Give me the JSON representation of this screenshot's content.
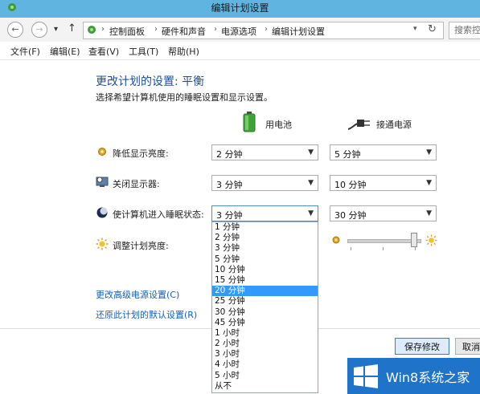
{
  "window": {
    "title": "编辑计划设置"
  },
  "nav": {
    "breadcrumbs": [
      "控制面板",
      "硬件和声音",
      "电源选项",
      "编辑计划设置"
    ],
    "search_placeholder": "搜索控制"
  },
  "menu": [
    "文件(F)",
    "编辑(E)",
    "查看(V)",
    "工具(T)",
    "帮助(H)"
  ],
  "main": {
    "heading": "更改计划的设置: 平衡",
    "subtitle": "选择希望计算机使用的睡眠设置和显示设置。",
    "columns": {
      "battery": "用电池",
      "plugged": "接通电源"
    },
    "rows": [
      {
        "label": "降低显示亮度:",
        "battery": "2 分钟",
        "plugged": "5 分钟",
        "icon": "dim-display-icon"
      },
      {
        "label": "关闭显示器:",
        "battery": "3 分钟",
        "plugged": "10 分钟",
        "icon": "monitor-icon"
      },
      {
        "label": "使计算机进入睡眠状态:",
        "battery": "3 分钟",
        "plugged": "30 分钟",
        "icon": "sleep-moon-icon"
      },
      {
        "label": "调整计划亮度:",
        "icon": "brightness-sun-icon"
      }
    ],
    "brightness_plugged_percent": 90,
    "links": {
      "advanced": "更改高级电源设置(C)",
      "restore": "还原此计划的默认设置(R)"
    }
  },
  "dropdown": {
    "options": [
      "1 分钟",
      "2 分钟",
      "3 分钟",
      "5 分钟",
      "10 分钟",
      "15 分钟",
      "20 分钟",
      "25 分钟",
      "30 分钟",
      "45 分钟",
      "1 小时",
      "2 小时",
      "3 小时",
      "4 小时",
      "5 小时",
      "从不"
    ],
    "highlighted": "20 分钟"
  },
  "footer": {
    "save": "保存修改",
    "cancel": "取消"
  },
  "watermark": {
    "text": "Win8系统之家"
  },
  "colors": {
    "titlebar": "#60b4e0",
    "heading": "#1f4e99",
    "link": "#1560b8",
    "highlight": "#3399ff",
    "watermark": "#1f73c9"
  }
}
